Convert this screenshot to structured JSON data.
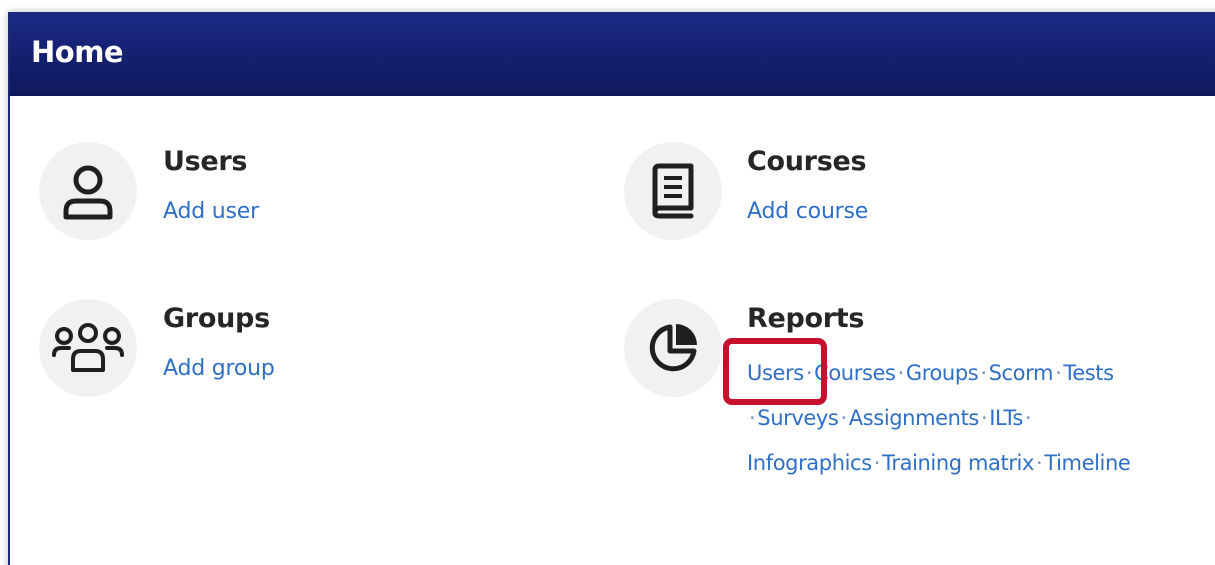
{
  "header": {
    "title": "Home"
  },
  "tiles": {
    "users": {
      "title": "Users",
      "link": "Add user",
      "icon": "user-icon"
    },
    "courses": {
      "title": "Courses",
      "link": "Add course",
      "icon": "book-icon"
    },
    "groups": {
      "title": "Groups",
      "link": "Add group",
      "icon": "group-icon"
    },
    "reports": {
      "title": "Reports",
      "icon": "pie-chart-icon"
    }
  },
  "reports_links": [
    "Users",
    "Courses",
    "Groups",
    "Scorm",
    "Tests",
    "Surveys",
    "Assignments",
    "ILTs",
    "Infographics",
    "Training matrix",
    "Timeline"
  ],
  "separator": "·",
  "colors": {
    "header_bg": "#14206f",
    "link": "#2f6fc6",
    "highlight": "#c8102e",
    "icon_bg": "#f1f1f1"
  }
}
